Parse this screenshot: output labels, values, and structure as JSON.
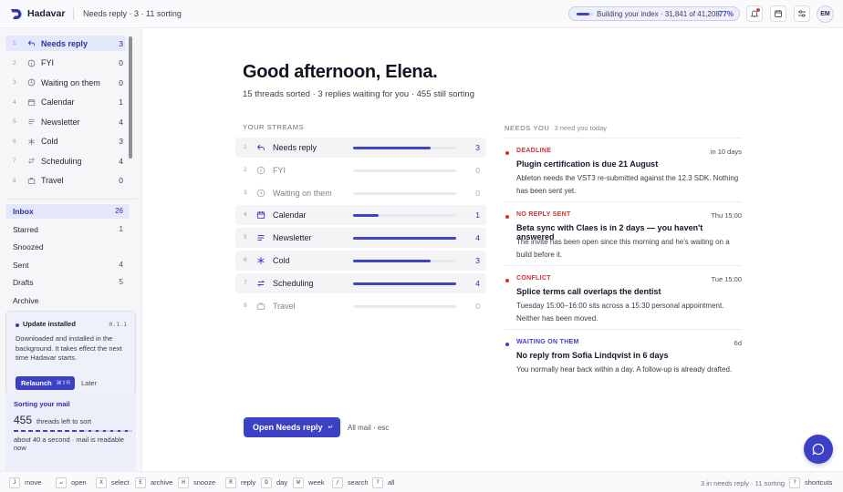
{
  "app": {
    "name": "Hadavar",
    "crumb": "Needs reply · 3 · 11 sorting"
  },
  "index_status": {
    "text": "Building your index · 31,841 of 41,208",
    "percent": "77%",
    "progress": 0.77
  },
  "user": {
    "initials": "EM"
  },
  "sidebar": {
    "streams": [
      {
        "num": "1",
        "label": "Needs reply",
        "count": "3",
        "icon": "reply-icon",
        "active": true
      },
      {
        "num": "2",
        "label": "FYI",
        "count": "0",
        "icon": "info-icon"
      },
      {
        "num": "3",
        "label": "Waiting on them",
        "count": "0",
        "icon": "clock-icon"
      },
      {
        "num": "4",
        "label": "Calendar",
        "count": "1",
        "icon": "calendar-icon"
      },
      {
        "num": "5",
        "label": "Newsletter",
        "count": "4",
        "icon": "lines-icon"
      },
      {
        "num": "6",
        "label": "Cold",
        "count": "3",
        "icon": "snowflake-icon"
      },
      {
        "num": "7",
        "label": "Scheduling",
        "count": "4",
        "icon": "swap-icon"
      },
      {
        "num": "8",
        "label": "Travel",
        "count": "0",
        "icon": "suitcase-icon"
      }
    ],
    "mailboxes": [
      {
        "label": "Inbox",
        "count": "26",
        "active": true
      },
      {
        "label": "Starred",
        "count": "1"
      },
      {
        "label": "Snoozed",
        "count": ""
      },
      {
        "label": "Sent",
        "count": "4"
      },
      {
        "label": "Drafts",
        "count": "5"
      },
      {
        "label": "Archive",
        "count": ""
      }
    ],
    "update_card": {
      "title": "Update installed",
      "version": "0.1.1",
      "body": "Downloaded and installed in the background. It takes effect the next time Hadavar starts.",
      "relaunch": "Relaunch",
      "relaunch_key": "⌘⇧R",
      "later": "Later"
    },
    "sorting_card": {
      "title": "Sorting your mail",
      "count": "455",
      "count_label": "threads left to sort",
      "eta": "about 40 a second · mail is readable now"
    }
  },
  "main": {
    "greeting": "Good afternoon, Elena.",
    "summary": "15 threads sorted · 3 replies waiting for you · 455 still sorting",
    "streams_heading": "YOUR STREAMS",
    "needs_heading": "NEEDS YOU",
    "needs_meta": "3 need you today",
    "streams": [
      {
        "num": "1",
        "label": "Needs reply",
        "count": "3",
        "fill": 0.75,
        "dim": false
      },
      {
        "num": "2",
        "label": "FYI",
        "count": "0",
        "fill": 0,
        "dim": true
      },
      {
        "num": "3",
        "label": "Waiting on them",
        "count": "0",
        "fill": 0,
        "dim": true
      },
      {
        "num": "4",
        "label": "Calendar",
        "count": "1",
        "fill": 0.25,
        "dim": false
      },
      {
        "num": "5",
        "label": "Newsletter",
        "count": "4",
        "fill": 1.0,
        "dim": false
      },
      {
        "num": "6",
        "label": "Cold",
        "count": "3",
        "fill": 0.75,
        "dim": false
      },
      {
        "num": "7",
        "label": "Scheduling",
        "count": "4",
        "fill": 1.0,
        "dim": false
      },
      {
        "num": "8",
        "label": "Travel",
        "count": "0",
        "fill": 0,
        "dim": true
      }
    ],
    "needs": [
      {
        "tag": "DEADLINE",
        "color": "#d62f2f",
        "when": "in 10 days",
        "subject": "Plugin certification is due 21 August",
        "desc": "Ableton needs the VST3 re-submitted against the 12.3 SDK. Nothing has been sent yet."
      },
      {
        "tag": "NO REPLY SENT",
        "color": "#d62f2f",
        "when": "Thu 15:00",
        "subject": "Beta sync with Claes is in 2 days — you haven't answered",
        "desc": "The invite has been open since this morning and he's waiting on a build before it."
      },
      {
        "tag": "CONFLICT",
        "color": "#d62f2f",
        "when": "Tue 15:00",
        "subject": "Splice terms call overlaps the dentist",
        "desc": "Tuesday 15:00–16:00 sits across a 15:30 personal appointment. Neither has been moved."
      },
      {
        "tag": "WAITING ON THEM",
        "color": "#3c40c6",
        "when": "6d",
        "subject": "No reply from Sofia Lindqvist in 6 days",
        "desc": "You normally hear back within a day. A follow-up is already drafted."
      }
    ],
    "open_button": "Open Needs reply",
    "open_key": "↵",
    "all_mail": "All mail · esc"
  },
  "footer": {
    "shortcuts": [
      {
        "key": "J",
        "label": "move"
      },
      {
        "key": "↵",
        "label": "open"
      },
      {
        "key": "X",
        "label": "select"
      },
      {
        "key": "E",
        "label": "archive"
      },
      {
        "key": "H",
        "label": "snooze"
      },
      {
        "key": "R",
        "label": "reply"
      },
      {
        "key": "D",
        "label": "day"
      },
      {
        "key": "W",
        "label": "week"
      },
      {
        "key": "/",
        "label": "search"
      },
      {
        "key": "?",
        "label": "all"
      }
    ],
    "status": "3 in needs reply · 11 sorting",
    "help_key": "?",
    "help_label": "shortcuts"
  },
  "colors": {
    "accent": "#3c40c6",
    "alert": "#d62f2f"
  }
}
